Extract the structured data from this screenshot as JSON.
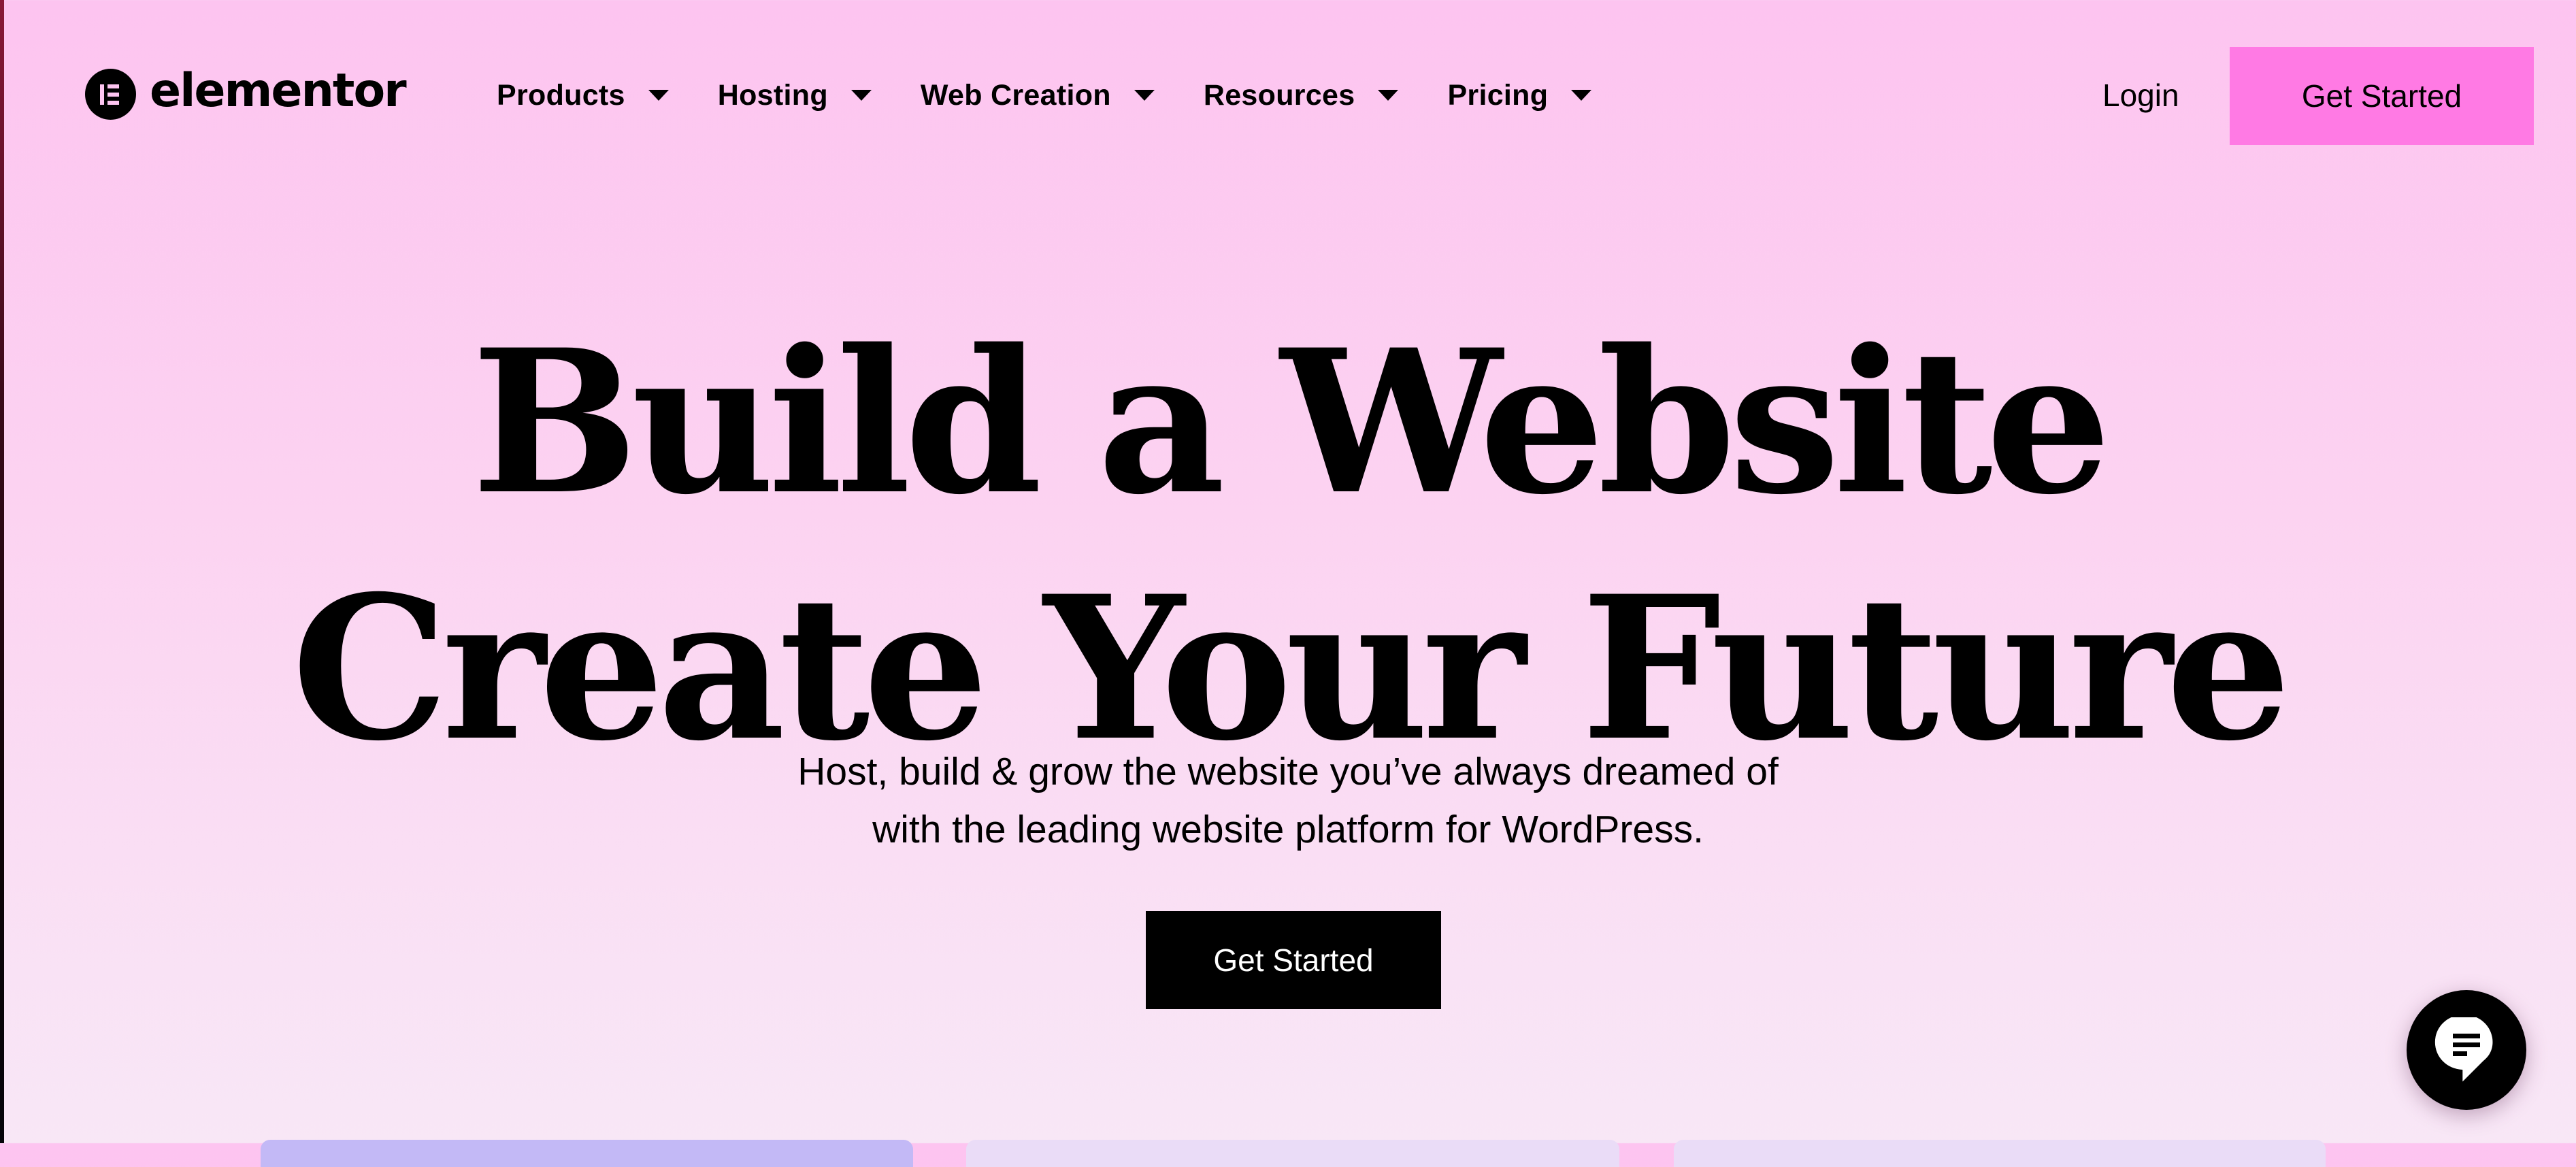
{
  "brand": {
    "name": "elementor",
    "logo_icon": "elementor-e-icon"
  },
  "header": {
    "nav": [
      {
        "label": "Products",
        "icon": "caret-down-icon"
      },
      {
        "label": "Hosting",
        "icon": "caret-down-icon"
      },
      {
        "label": "Web Creation",
        "icon": "caret-down-icon"
      },
      {
        "label": "Resources",
        "icon": "caret-down-icon"
      },
      {
        "label": "Pricing",
        "icon": "caret-down-icon"
      }
    ],
    "login_label": "Login",
    "cta_label": "Get Started"
  },
  "hero": {
    "title_line1": "Build a Website",
    "title_line2": "Create Your Future",
    "subtitle_line1": "Host, build & grow the website you’ve always dreamed of",
    "subtitle_line2": "with the leading website platform for WordPress.",
    "cta_label": "Get Started"
  },
  "chat_widget": {
    "icon": "chat-bubble-icon"
  },
  "colors": {
    "background_top": "#fdc4f0",
    "background_bottom": "#f8e7f6",
    "header_cta": "#ff7ae4",
    "primary_cta": "#000000",
    "card_accent": "#c3b9f6",
    "card_muted": "#eadcf7"
  }
}
